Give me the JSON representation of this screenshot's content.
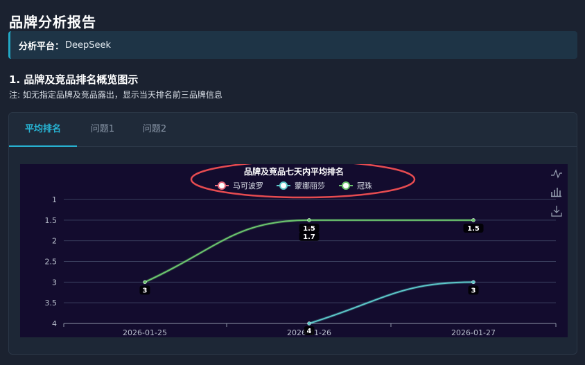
{
  "page": {
    "title": "品牌分析报告",
    "platform_label": "分析平台：",
    "platform_value": "DeepSeek",
    "section_title": "1. 品牌及竞品排名概览图示",
    "section_note": "注: 如无指定品牌及竞品露出，显示当天排名前三品牌信息"
  },
  "tabs": [
    {
      "label": "平均排名",
      "active": true
    },
    {
      "label": "问题1",
      "active": false
    },
    {
      "label": "问题2",
      "active": false
    }
  ],
  "toolbox": [
    "line-chart-icon",
    "bar-chart-icon",
    "download-icon"
  ],
  "chart_data": {
    "type": "line",
    "title": "品牌及竞品七天内平均排名",
    "xlabel": "",
    "ylabel": "",
    "categories": [
      "2026-01-25",
      "2026-01-26",
      "2026-01-27"
    ],
    "y_ticks": [
      "1",
      "1.5",
      "2",
      "2.5",
      "3",
      "3.5",
      "4"
    ],
    "ylim": [
      1,
      4
    ],
    "y_inverted": true,
    "grid": true,
    "legend_position": "top-center",
    "series": [
      {
        "name": "马可波罗",
        "color": "#e86b7e",
        "values": [
          null,
          1.7,
          null
        ],
        "labels": [
          null,
          "1.7",
          null
        ]
      },
      {
        "name": "蒙娜丽莎",
        "color": "#5cc7c9",
        "values": [
          null,
          4,
          3
        ],
        "labels": [
          null,
          "4",
          "3"
        ]
      },
      {
        "name": "冠珠",
        "color": "#6cc66e",
        "values": [
          3,
          1.5,
          1.5
        ],
        "labels": [
          "3",
          "1.5",
          "1.5"
        ]
      }
    ]
  }
}
